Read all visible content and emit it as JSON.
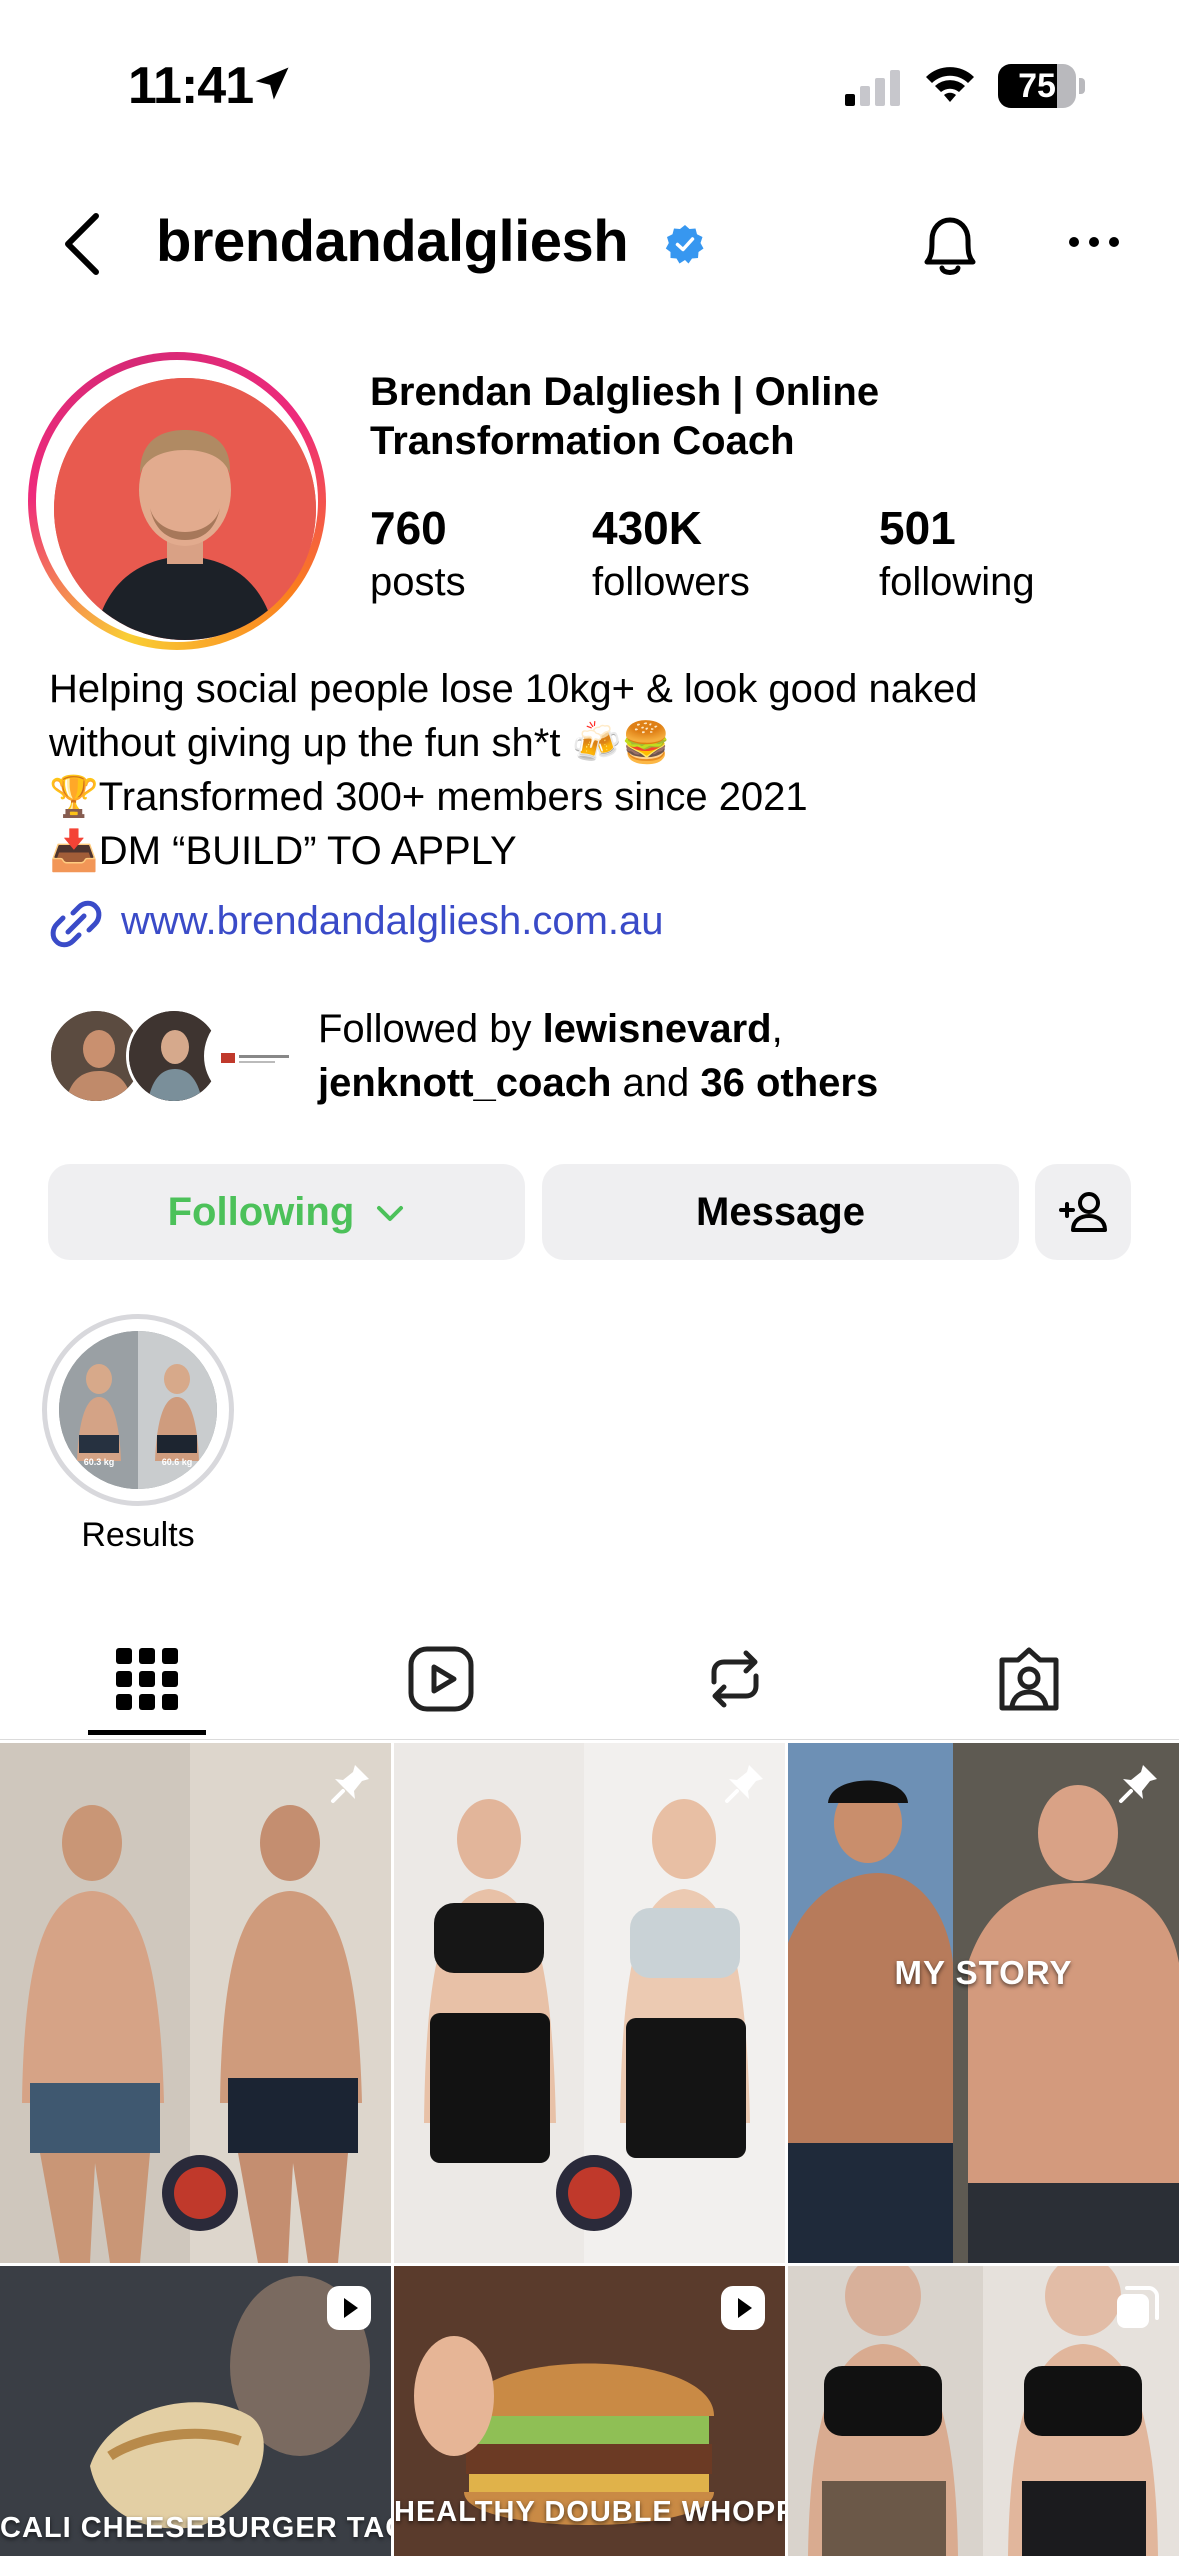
{
  "status_bar": {
    "time": "11:41",
    "battery": "75",
    "battery_level": 0.75
  },
  "header": {
    "username": "brendandalgliesh",
    "verified": true
  },
  "profile": {
    "full_name_line1": "Brendan Dalgliesh | Online",
    "full_name_line2": "Transformation Coach",
    "stats": [
      {
        "value": "760",
        "label": "posts"
      },
      {
        "value": "430K",
        "label": "followers"
      },
      {
        "value": "501",
        "label": "following"
      }
    ],
    "bio": [
      "Helping social people lose 10kg+ & look good naked",
      "without giving up the fun sh*t 🍻🍔",
      "🏆Transformed 300+ members since 2021",
      "📥DM “BUILD” TO APPLY"
    ],
    "link": "www.brendandalgliesh.com.au"
  },
  "followed_by": {
    "prefix": "Followed by ",
    "user1": "lewisnevard",
    "comma": ",",
    "user2": "jenknott_coach",
    "and": " and ",
    "others": "36 others"
  },
  "actions": {
    "following_label": "Following",
    "message_label": "Message"
  },
  "highlights": [
    {
      "label": "Results",
      "left_weight": "60.3 kg",
      "right_weight": "60.6 kg"
    }
  ],
  "tabs": [
    "posts-grid",
    "reels",
    "reposts",
    "tagged"
  ],
  "grid": {
    "captions": {
      "my_story": "MY STORY",
      "taco": "CALI CHEESEBURGER TACO?",
      "whopper": "HEALTHY DOUBLE WHOPPER?"
    }
  },
  "colors": {
    "following": "#4cc15a",
    "link": "#3a4bc8",
    "verified": "#3797f0"
  }
}
